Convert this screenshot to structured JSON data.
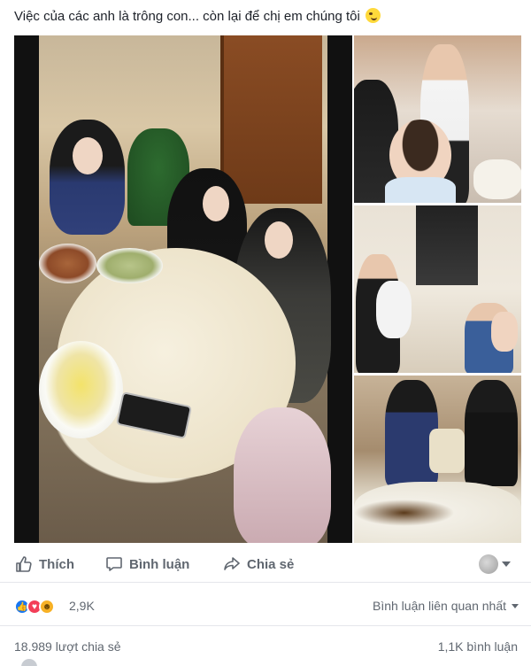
{
  "post": {
    "caption": "Việc của các anh là trông con... còn lại để chị em chúng tôi",
    "caption_emoji": "face-with-tongue-emoji"
  },
  "media": {
    "photos": [
      {
        "id": "main",
        "icon": "dinner-table-photo"
      },
      {
        "id": "top-right",
        "icon": "father-holding-baby-photo"
      },
      {
        "id": "middle-right",
        "icon": "men-holding-babies-photo"
      },
      {
        "id": "bottom-right",
        "icon": "women-toasting-photo"
      }
    ]
  },
  "actions": {
    "like_label": "Thích",
    "comment_label": "Bình luận",
    "share_label": "Chia sẻ"
  },
  "reactions": {
    "types": [
      "like",
      "love",
      "haha"
    ],
    "count": "2,9K",
    "sort_label": "Bình luận liên quan nhất"
  },
  "stats": {
    "shares": "18.989 lượt chia sẻ",
    "comments": "1,1K bình luận"
  },
  "colors": {
    "accent": "#1877f2",
    "love": "#f33e58",
    "haha": "#f7b125",
    "muted_text": "#606770"
  }
}
